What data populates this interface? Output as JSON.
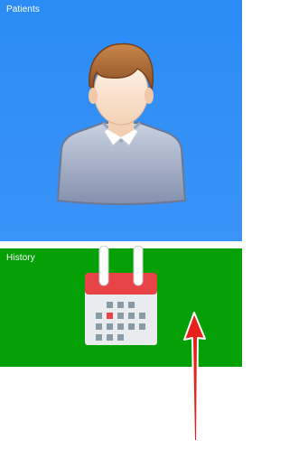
{
  "tiles": [
    {
      "label": "Patients",
      "icon": "person-icon",
      "color": "#2b8cf6"
    },
    {
      "label": "History",
      "icon": "calendar-icon",
      "color": "#05a005"
    }
  ],
  "annotation": {
    "type": "arrow",
    "color": "#e8201c"
  }
}
